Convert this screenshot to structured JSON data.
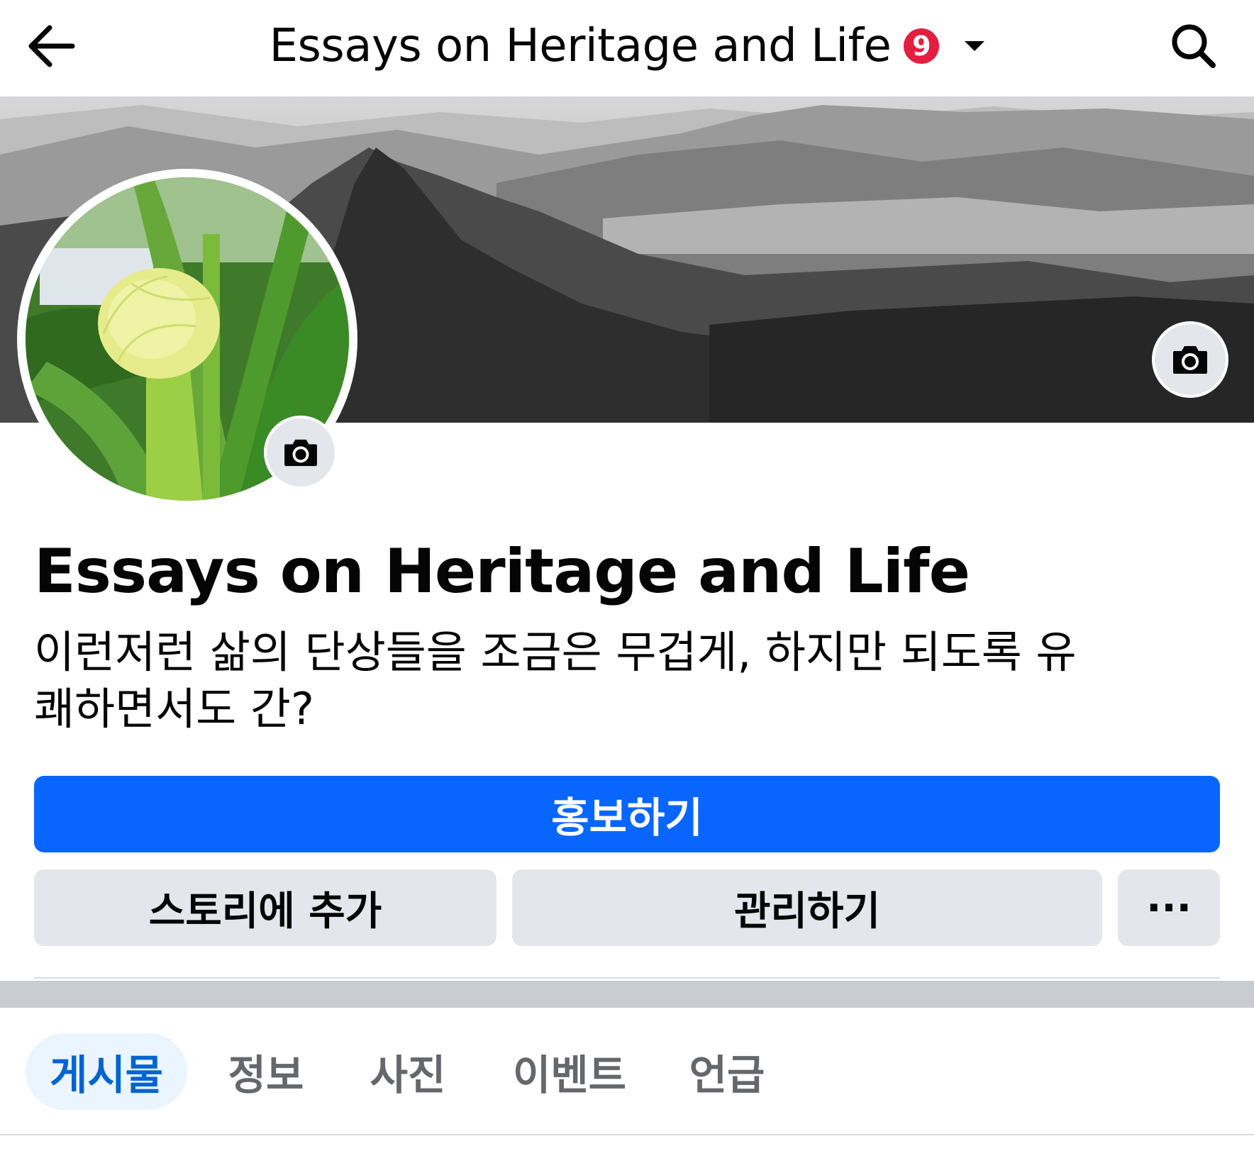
{
  "header": {
    "title": "Essays on Heritage and Life",
    "notification_count": "9"
  },
  "icons": {
    "back": "arrow-left-icon",
    "dropdown": "caret-down-icon",
    "search": "search-icon",
    "cover_camera": "camera-icon",
    "profile_camera": "camera-icon"
  },
  "profile": {
    "name": "Essays on Heritage and Life",
    "description": "이런저런 삶의 단상들을 조금은 무겁게, 하지만 되도록 유쾌하면서도 간?"
  },
  "actions": {
    "promote_label": "홍보하기",
    "add_story_label": "스토리에 추가",
    "manage_label": "관리하기",
    "more_label": "···"
  },
  "tabs": [
    {
      "label": "게시물",
      "active": true
    },
    {
      "label": "정보",
      "active": false
    },
    {
      "label": "사진",
      "active": false
    },
    {
      "label": "이벤트",
      "active": false
    },
    {
      "label": "언급",
      "active": false
    }
  ],
  "colors": {
    "primary": "#0866ff",
    "badge": "#e41e3f",
    "active_tab_bg": "#ebf5ff",
    "active_tab_text": "#0064d1"
  }
}
